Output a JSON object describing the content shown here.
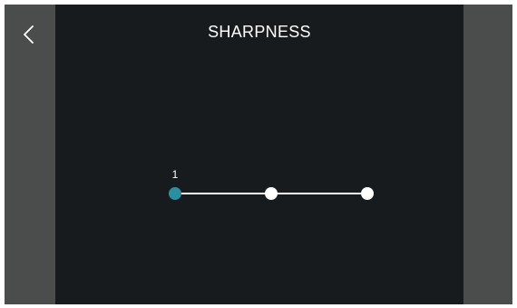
{
  "screen": {
    "title": "SHARPNESS"
  },
  "slider": {
    "selected_index": 0,
    "selected_label": "1",
    "step_count": 3,
    "accent_color": "#2a8fa0",
    "track_color": "#ffffff"
  },
  "icons": {
    "back": "chevron-left-icon"
  },
  "colors": {
    "background": "#181b1d",
    "side_panels": "#4b4d4c",
    "text": "#ffffff"
  }
}
